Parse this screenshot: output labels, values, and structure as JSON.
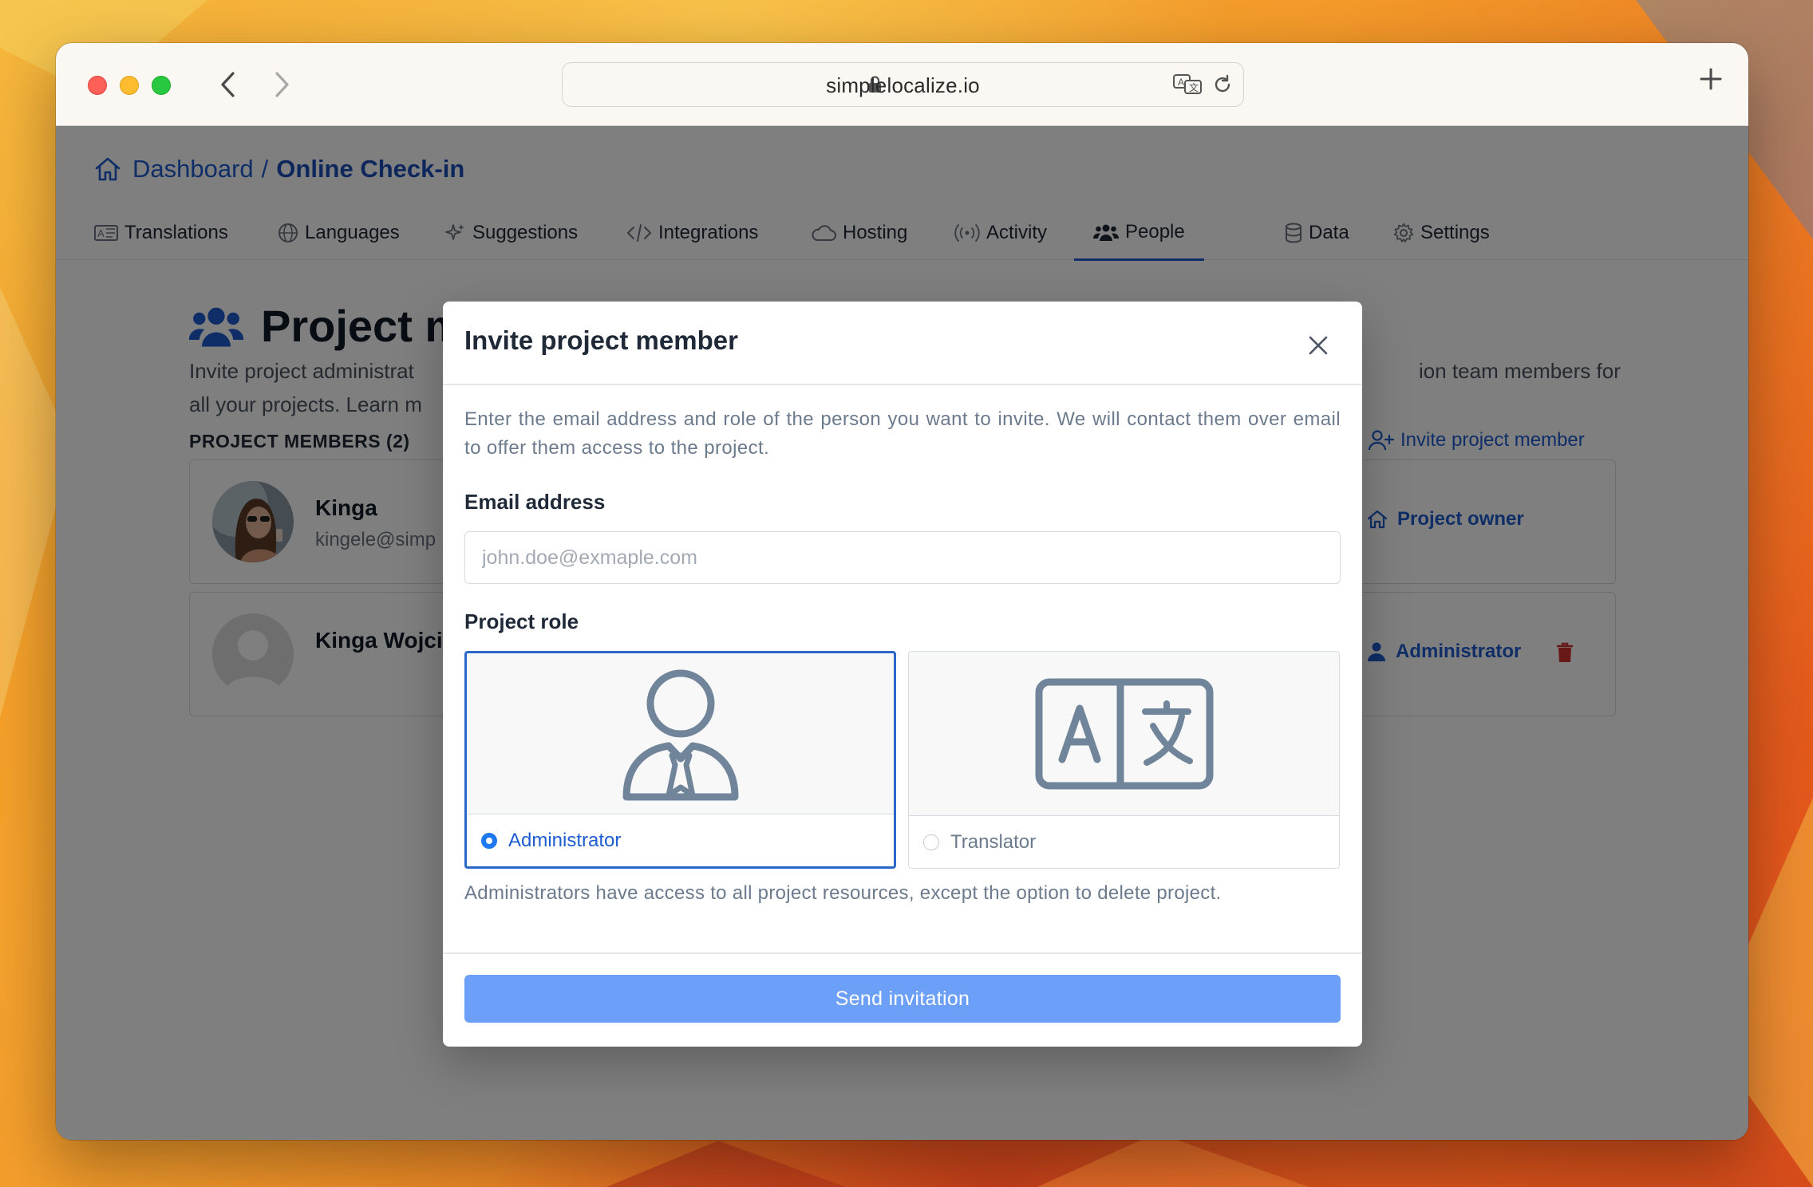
{
  "browser": {
    "url": "simplelocalize.io"
  },
  "breadcrumb": {
    "root": "Dashboard",
    "separator": "/",
    "current": "Online Check-in"
  },
  "tabs": [
    {
      "label": "Translations",
      "icon": "translations-icon"
    },
    {
      "label": "Languages",
      "icon": "globe-icon"
    },
    {
      "label": "Suggestions",
      "icon": "sparkle-icon"
    },
    {
      "label": "Integrations",
      "icon": "code-icon"
    },
    {
      "label": "Hosting",
      "icon": "cloud-icon"
    },
    {
      "label": "Activity",
      "icon": "broadcast-icon"
    },
    {
      "label": "People",
      "icon": "people-icon",
      "active": true
    },
    {
      "label": "Data",
      "icon": "database-icon"
    },
    {
      "label": "Settings",
      "icon": "gear-icon"
    }
  ],
  "page": {
    "title": "Project m",
    "description_left_line1": "Invite project administrat",
    "description_right_line1": "ion team members for",
    "description_line2": "all your projects. Learn m",
    "members_header": "PROJECT MEMBERS (2)",
    "invite_link": "Invite project member",
    "members": [
      {
        "name": "Kinga",
        "email": "kingele@simp",
        "role": "Project owner"
      },
      {
        "name": "Kinga Wojcic",
        "email": "",
        "role": "Administrator"
      }
    ]
  },
  "modal": {
    "title": "Invite project member",
    "description": "Enter the email address and role of the person you want to invite. We will contact them over email to offer them access to the project.",
    "email_label": "Email address",
    "email_value": "",
    "email_placeholder": "john.doe@exmaple.com",
    "role_label": "Project role",
    "roles": [
      {
        "label": "Administrator",
        "selected": true
      },
      {
        "label": "Translator",
        "selected": false
      }
    ],
    "role_note": "Administrators have access to all project resources, except the option to delete project.",
    "submit_label": "Send invitation"
  },
  "colors": {
    "accent": "#1e5ccf",
    "button": "#6b9ff8",
    "danger": "#d0312d"
  }
}
